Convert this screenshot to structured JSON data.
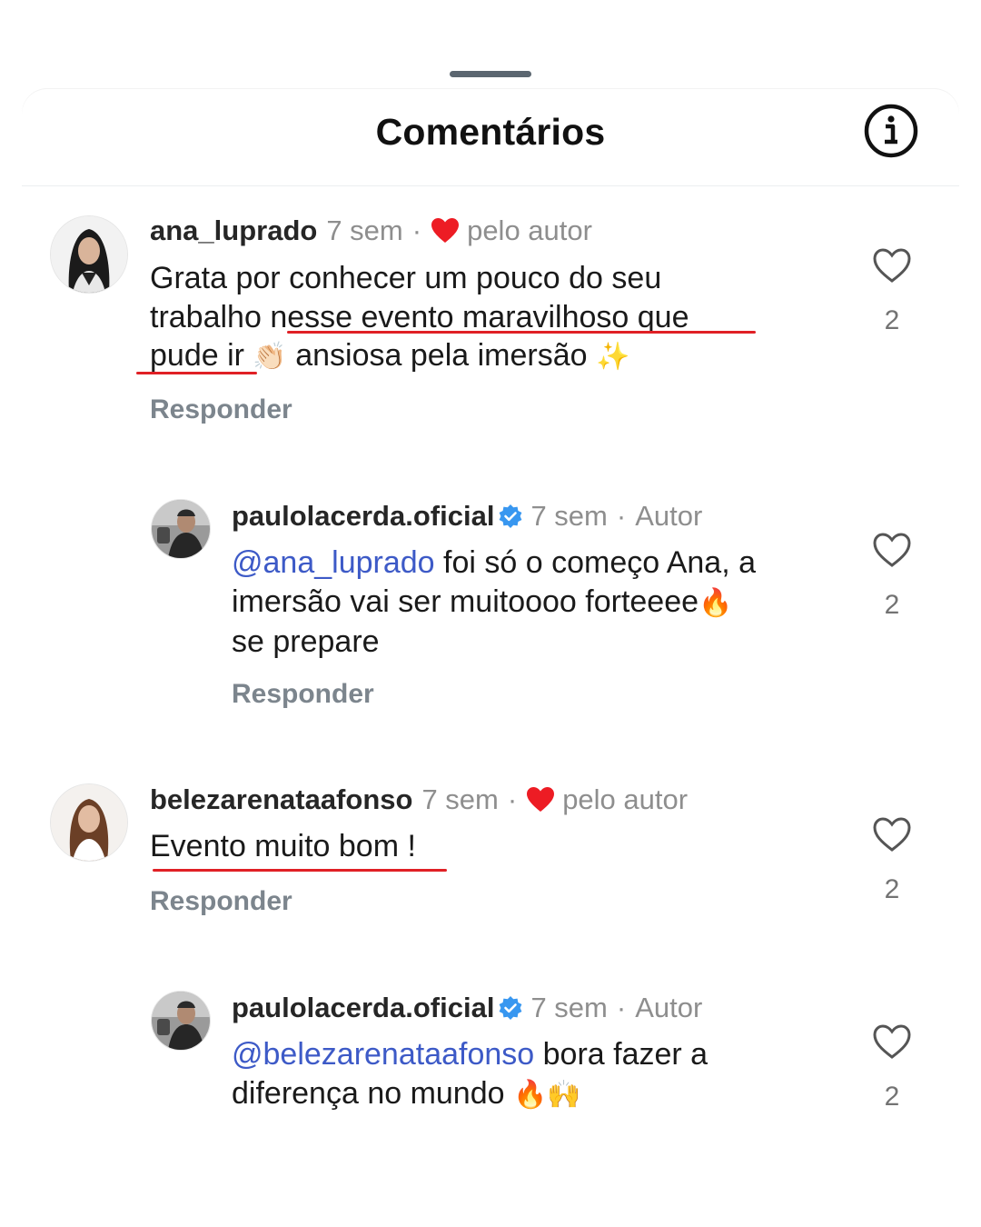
{
  "header": {
    "title": "Comentários"
  },
  "comments": [
    {
      "username": "ana_luprado",
      "time": "7 sem",
      "separator": "·",
      "author_like_label": "pelo autor",
      "body_line1": "Grata por conhecer um pouco do seu",
      "body_line2_plain": "trabalho ",
      "body_line2_underlined": "nesse evento maravilhoso que",
      "body_line3_underlined": "pude ir",
      "body_line3_emoji1": "👏🏻",
      "body_line3_rest": "ansiosa pela imersão",
      "body_line3_emoji2": "✨",
      "reply_label": "Responder",
      "likes": "2"
    },
    {
      "username": "paulolacerda.oficial",
      "time": "7 sem",
      "separator": "·",
      "author_tag": "Autor",
      "mention": "@ana_luprado",
      "body_line1_rest": " foi só o começo Ana, a",
      "body_line2": "imersão vai ser muitoooo forteeee",
      "body_line2_emoji": "🔥",
      "body_line3": "se prepare",
      "reply_label": "Responder",
      "likes": "2"
    },
    {
      "username": "belezarenataafonso",
      "time": "7 sem",
      "separator": "·",
      "author_like_label": "pelo autor",
      "body": "Evento muito bom !",
      "reply_label": "Responder",
      "likes": "2"
    },
    {
      "username": "paulolacerda.oficial",
      "time": "7 sem",
      "separator": "·",
      "author_tag": "Autor",
      "mention": "@belezarenataafonso",
      "body_line1_rest": " bora fazer a",
      "body_line2": "diferença no mundo",
      "body_line2_emoji": "🔥🙌",
      "likes": "2"
    }
  ],
  "colors": {
    "mention": "#3d5ac7",
    "verified": "#3897f0",
    "heart_red": "#ed1c24",
    "underline": "#e02025"
  }
}
